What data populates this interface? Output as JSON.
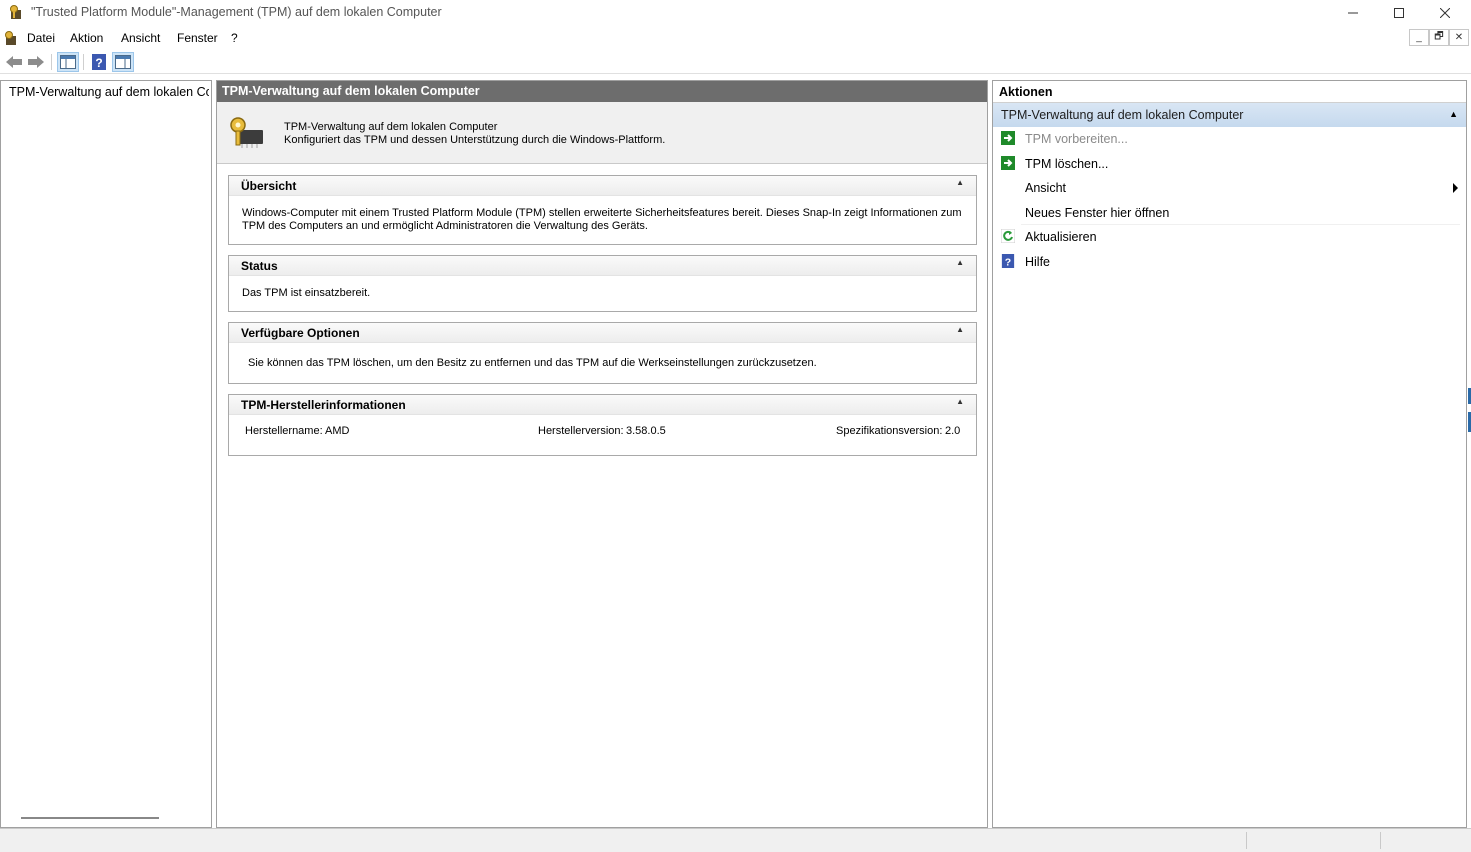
{
  "window": {
    "title": "\"Trusted Platform Module\"-Management (TPM) auf dem lokalen Computer",
    "controls": {
      "minimize": "—",
      "maximize": "☐",
      "close": "✕"
    }
  },
  "menu": {
    "items": [
      "Datei",
      "Aktion",
      "Ansicht",
      "Fenster",
      "?"
    ],
    "mdi_controls": {
      "minimize": "_",
      "restore": "🗗",
      "close": "✕"
    }
  },
  "toolbar": {
    "buttons": [
      "back-arrow-icon",
      "forward-arrow-icon",
      "show-hide-console-tree-icon",
      "help-icon",
      "show-hide-action-pane-icon"
    ]
  },
  "tree": {
    "root_label": "TPM-Verwaltung auf dem lokalen Computer"
  },
  "center": {
    "header": "TPM-Verwaltung auf dem lokalen Computer",
    "intro": {
      "title": "TPM-Verwaltung auf dem lokalen Computer",
      "description": "Konfiguriert das TPM und dessen Unterstützung durch die Windows-Plattform."
    },
    "sections": {
      "overview": {
        "title": "Übersicht",
        "body": "Windows-Computer mit einem Trusted Platform Module (TPM) stellen erweiterte Sicherheitsfeatures bereit. Dieses Snap-In zeigt Informationen zum TPM des Computers an und ermöglicht Administratoren die Verwaltung des Geräts."
      },
      "status": {
        "title": "Status",
        "body": "Das TPM ist einsatzbereit."
      },
      "options": {
        "title": "Verfügbare Optionen",
        "body": "Sie können das TPM löschen, um den Besitz zu entfernen und das TPM auf die Werkseinstellungen zurückzusetzen."
      },
      "manufacturer": {
        "title": "TPM-Herstellerinformationen",
        "name_label": "Herstellername:",
        "name_value": "AMD",
        "version_label": "Herstellerversion:",
        "version_value": "3.58.0.5",
        "spec_label": "Spezifikationsversion:",
        "spec_value": "2.0"
      }
    },
    "collapse_glyph": "▲"
  },
  "actions": {
    "header": "Aktionen",
    "group_label": "TPM-Verwaltung auf dem lokalen Computer",
    "group_caret": "▲",
    "items": [
      {
        "label": "TPM vorbereiten...",
        "icon": "green-arrow-icon",
        "enabled": false
      },
      {
        "label": "TPM löschen...",
        "icon": "green-arrow-icon",
        "enabled": true
      },
      {
        "label": "Ansicht",
        "icon": "",
        "enabled": true,
        "submenu": true
      },
      {
        "label": "Neues Fenster hier öffnen",
        "icon": "",
        "enabled": true
      },
      {
        "label": "Aktualisieren",
        "icon": "refresh-icon",
        "enabled": true
      },
      {
        "label": "Hilfe",
        "icon": "help-icon",
        "enabled": true
      }
    ]
  },
  "colors": {
    "center_header_bg": "#6d6d6d",
    "action_group_bg": "#c5d9ee",
    "disabled_text": "#8a8a8a"
  }
}
